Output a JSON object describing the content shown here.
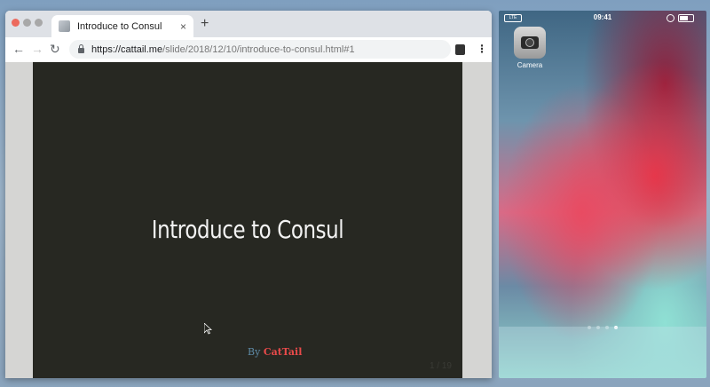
{
  "browser": {
    "tab_title": "Introduce to Consul",
    "tab_close": "×",
    "new_tab": "+",
    "nav": {
      "back": "←",
      "forward": "→",
      "reload": "↻"
    },
    "url_host": "https://cattail.me",
    "url_path": "/slide/2018/12/10/introduce-to-consul.html#1",
    "menu": "⋮"
  },
  "slide": {
    "title": "Introduce to Consul",
    "by": "By",
    "author": "CatTail",
    "page": "1 / 19"
  },
  "phone": {
    "time": "09:41",
    "carrier": "LTE",
    "app_label": "Camera",
    "page_count": 4,
    "active_page": 4
  },
  "colors": {
    "slide_bg": "#272822",
    "author": "#e84a4a",
    "by": "#5e8aa6"
  }
}
